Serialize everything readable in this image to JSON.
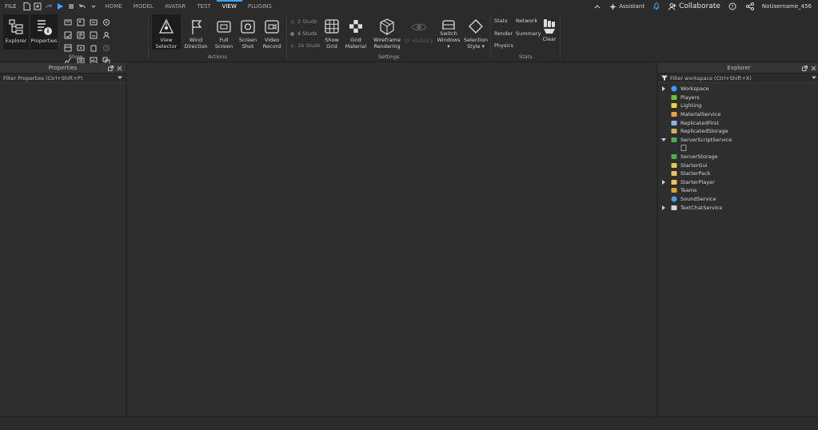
{
  "menubar": {
    "file": "FILE",
    "tabs": [
      "HOME",
      "MODEL",
      "AVATAR",
      "TEST",
      "VIEW",
      "PLUGINS"
    ],
    "active_tab": "VIEW",
    "assistant": "Assistant",
    "collaborate": "Collaborate",
    "username": "NoUsername_456"
  },
  "ribbon": {
    "show": {
      "explorer": "Explorer",
      "properties": "Properties",
      "group": "Show"
    },
    "actions": {
      "view_selector": [
        "View",
        "Selector"
      ],
      "wind_direction": [
        "Wind",
        "Direction"
      ],
      "full_screen": [
        "Full",
        "Screen"
      ],
      "screen_shot": [
        "Screen",
        "Shot"
      ],
      "video_record": [
        "Video",
        "Record"
      ],
      "group": "Actions"
    },
    "settings": {
      "studs": [
        "2 Studs",
        "4 Studs",
        "16 Studs"
      ],
      "show_grid": [
        "Show",
        "Grid"
      ],
      "grid_material": [
        "Grid",
        "Material"
      ],
      "wireframe": [
        "Wireframe",
        "Rendering"
      ],
      "ui_visibility": "UI Visibility",
      "switch_windows": [
        "Switch",
        "Windows ▾"
      ],
      "selection_style": [
        "Selection",
        "Style ▾"
      ],
      "group": "Settings"
    },
    "stats": {
      "stats": "Stats",
      "network": "Network",
      "render": "Render",
      "summary": "Summary",
      "physics": "Physics",
      "clear": "Clear",
      "group": "Stats"
    }
  },
  "properties": {
    "title": "Properties",
    "filter": "Filter Properties (Ctrl+Shift+P)"
  },
  "explorer": {
    "title": "Explorer",
    "filter": "Filter workspace (Ctrl+Shift+X)",
    "items": [
      {
        "label": "Workspace",
        "expand": "collapsed",
        "icon": "workspace-icon",
        "color": "#3aa0ff"
      },
      {
        "label": "Players",
        "expand": "none",
        "icon": "players-icon",
        "color": "#6fbf3f"
      },
      {
        "label": "Lighting",
        "expand": "none",
        "icon": "lighting-icon",
        "color": "#f2d33b"
      },
      {
        "label": "MaterialService",
        "expand": "none",
        "icon": "material-service-icon",
        "color": "#e8a24a"
      },
      {
        "label": "ReplicatedFirst",
        "expand": "none",
        "icon": "replicated-first-icon",
        "color": "#8fb3d9"
      },
      {
        "label": "ReplicatedStorage",
        "expand": "none",
        "icon": "replicated-storage-icon",
        "color": "#cbb06a"
      },
      {
        "label": "ServerScriptService",
        "expand": "expanded",
        "icon": "server-script-service-icon",
        "color": "#4caf50"
      },
      {
        "label": "",
        "expand": "none",
        "icon": "script-icon",
        "color": "#9a9a9a",
        "child": true
      },
      {
        "label": "ServerStorage",
        "expand": "none",
        "icon": "server-storage-icon",
        "color": "#4caf50"
      },
      {
        "label": "StarterGui",
        "expand": "none",
        "icon": "starter-gui-icon",
        "color": "#e8c55a"
      },
      {
        "label": "StarterPack",
        "expand": "none",
        "icon": "starter-pack-icon",
        "color": "#e8c55a"
      },
      {
        "label": "StarterPlayer",
        "expand": "collapsed",
        "icon": "starter-player-icon",
        "color": "#e8c55a"
      },
      {
        "label": "Teams",
        "expand": "none",
        "icon": "teams-icon",
        "color": "#e0a030"
      },
      {
        "label": "SoundService",
        "expand": "none",
        "icon": "sound-service-icon",
        "color": "#4aa0e0"
      },
      {
        "label": "TextChatService",
        "expand": "collapsed",
        "icon": "text-chat-service-icon",
        "color": "#d8d8d8"
      }
    ]
  }
}
